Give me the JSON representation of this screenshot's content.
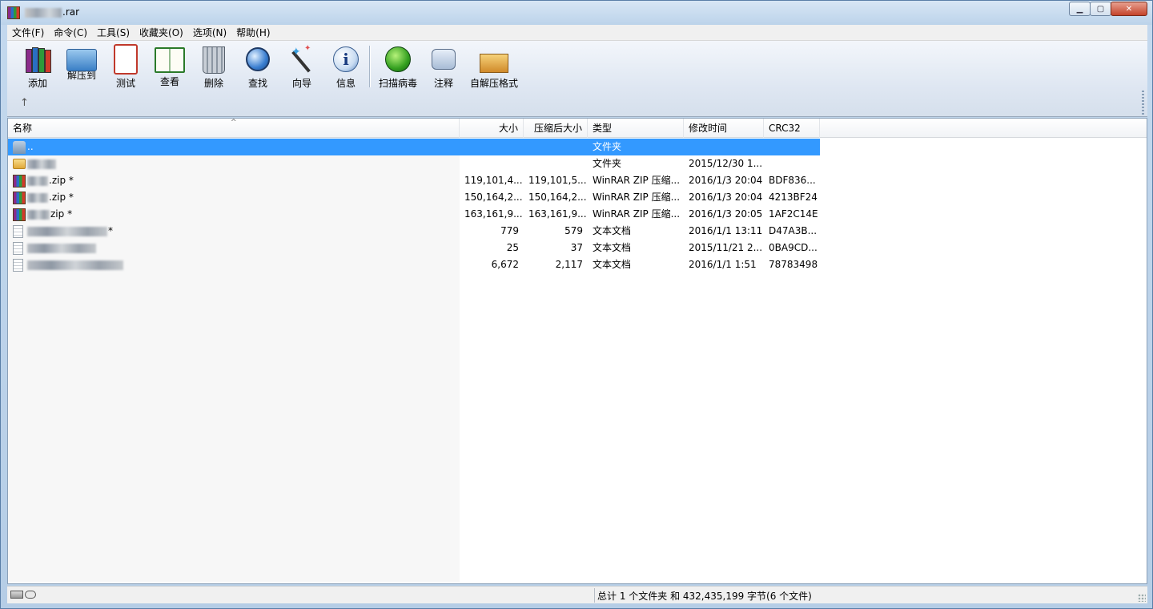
{
  "window": {
    "title_visible_suffix": ".rar",
    "buttons": {
      "minimize": "▁",
      "maximize": "▢",
      "close": "✕"
    }
  },
  "menu": [
    {
      "label": "文件(F)"
    },
    {
      "label": "命令(C)"
    },
    {
      "label": "工具(S)"
    },
    {
      "label": "收藏夹(O)"
    },
    {
      "label": "选项(N)"
    },
    {
      "label": "帮助(H)"
    }
  ],
  "toolbar": {
    "tools": [
      {
        "label": "添加",
        "icon": "books-icon"
      },
      {
        "label": "解压到",
        "icon": "folder-icon"
      },
      {
        "label": "测试",
        "icon": "clipboard-icon"
      },
      {
        "label": "查看",
        "icon": "book-icon"
      },
      {
        "label": "删除",
        "icon": "trash-icon"
      },
      {
        "label": "查找",
        "icon": "magnifier-icon"
      },
      {
        "label": "向导",
        "icon": "wand-icon"
      },
      {
        "label": "信息",
        "icon": "info-icon"
      },
      {
        "label": "扫描病毒",
        "icon": "bug-icon"
      },
      {
        "label": "注释",
        "icon": "comment-icon"
      },
      {
        "label": "自解压格式",
        "icon": "sfx-box-icon"
      }
    ],
    "up_arrow": "↑"
  },
  "list": {
    "columns": [
      "名称",
      "大小",
      "压缩后大小",
      "类型",
      "修改时间",
      "CRC32"
    ],
    "rows": [
      {
        "icon": "up-folder-icon",
        "name": "..",
        "blur": 0,
        "size": "",
        "packed": "",
        "type": "文件夹",
        "modified": "",
        "crc": "",
        "selected": true
      },
      {
        "icon": "folder-icon",
        "name": "",
        "blur": 36,
        "size": "",
        "packed": "",
        "type": "文件夹",
        "modified": "2015/12/30 1...",
        "crc": "",
        "selected": false
      },
      {
        "icon": "rar-file-icon",
        "name": ".zip *",
        "blur": 26,
        "size": "119,101,4...",
        "packed": "119,101,5...",
        "type": "WinRAR ZIP 压缩...",
        "modified": "2016/1/3 20:04",
        "crc": "BDF836...",
        "selected": false
      },
      {
        "icon": "rar-file-icon",
        "name": ".zip *",
        "blur": 26,
        "size": "150,164,2...",
        "packed": "150,164,2...",
        "type": "WinRAR ZIP 压缩...",
        "modified": "2016/1/3 20:04",
        "crc": "4213BF24",
        "selected": false
      },
      {
        "icon": "rar-file-icon",
        "name": "zip *",
        "blur": 28,
        "size": "163,161,9...",
        "packed": "163,161,9...",
        "type": "WinRAR ZIP 压缩...",
        "modified": "2016/1/3 20:05",
        "crc": "1AF2C14E",
        "selected": false
      },
      {
        "icon": "text-file-icon",
        "name": "*",
        "blur": 100,
        "size": "779",
        "packed": "579",
        "type": "文本文档",
        "modified": "2016/1/1 13:11",
        "crc": "D47A3B...",
        "selected": false
      },
      {
        "icon": "text-file-icon",
        "name": "",
        "blur": 86,
        "size": "25",
        "packed": "37",
        "type": "文本文档",
        "modified": "2015/11/21 2...",
        "crc": "0BA9CD...",
        "selected": false
      },
      {
        "icon": "text-file-icon",
        "name": "",
        "blur": 120,
        "size": "6,672",
        "packed": "2,117",
        "type": "文本文档",
        "modified": "2016/1/1 1:51",
        "crc": "78783498",
        "selected": false
      }
    ]
  },
  "status": {
    "summary": "总计 1 个文件夹 和 432,435,199 字节(6 个文件)"
  }
}
